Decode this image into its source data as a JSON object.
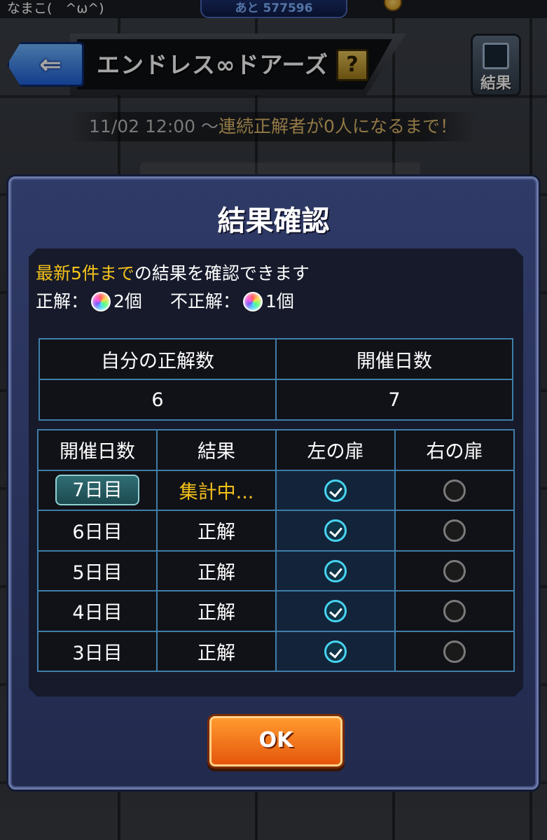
{
  "status_bar": {
    "player_name": "なまこ(　^ω^)",
    "remaining": "あと 577596"
  },
  "header": {
    "title": "エンドレス∞ドアーズ",
    "help_label": "?",
    "results_label": "結果"
  },
  "event": {
    "date": "11/02 12:00 ～",
    "condition": "連続正解者が0人になるまで！"
  },
  "dialog": {
    "title": "結果確認",
    "info_highlight": "最新5件まで",
    "info_rest": "の結果を確認できます",
    "correct_label": "正解：",
    "correct_count": "2個",
    "incorrect_label": "不正解：",
    "incorrect_count": "1個",
    "summary": {
      "headers": [
        "自分の正解数",
        "開催日数"
      ],
      "values": [
        "6",
        "7"
      ]
    },
    "history": {
      "headers": [
        "開催日数",
        "結果",
        "左の扉",
        "右の扉"
      ],
      "rows": [
        {
          "day": "7日目",
          "result": "集計中...",
          "left": "checked",
          "right": "unchecked"
        },
        {
          "day": "6日目",
          "result": "正解",
          "left": "checked",
          "right": "unchecked"
        },
        {
          "day": "5日目",
          "result": "正解",
          "left": "checked",
          "right": "unchecked"
        },
        {
          "day": "4日目",
          "result": "正解",
          "left": "checked",
          "right": "unchecked"
        },
        {
          "day": "3日目",
          "result": "正解",
          "left": "checked",
          "right": "unchecked"
        }
      ]
    },
    "ok_label": "OK"
  }
}
